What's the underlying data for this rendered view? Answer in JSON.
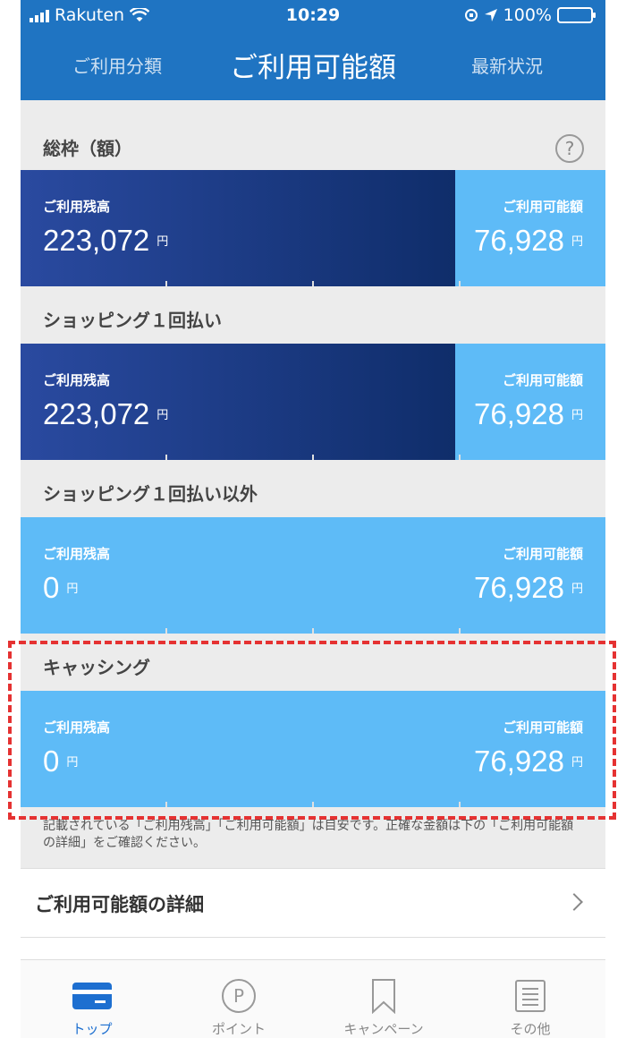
{
  "status": {
    "carrier": "Rakuten",
    "time": "10:29",
    "battery": "100%"
  },
  "header": {
    "left_tab": "ご利用分類",
    "title": "ご利用可能額",
    "right_tab": "最新状況"
  },
  "sections": [
    {
      "title": "総枠（額）",
      "used_label": "ご利用残高",
      "used": "223,072",
      "avail_label": "ご利用可能額",
      "avail": "76,928",
      "unit": "円",
      "dark": true
    },
    {
      "title": "ショッピング１回払い",
      "used_label": "ご利用残高",
      "used": "223,072",
      "avail_label": "ご利用可能額",
      "avail": "76,928",
      "unit": "円",
      "dark": true
    },
    {
      "title": "ショッピング１回払い以外",
      "used_label": "ご利用残高",
      "used": "0",
      "avail_label": "ご利用可能額",
      "avail": "76,928",
      "unit": "円",
      "dark": false
    },
    {
      "title": "キャッシング",
      "used_label": "ご利用残高",
      "used": "0",
      "avail_label": "ご利用可能額",
      "avail": "76,928",
      "unit": "円",
      "dark": false
    }
  ],
  "help_symbol": "?",
  "note": "記載されている「ご利用残高」「ご利用可能額」は目安です。正確な金額は下の「ご利用可能額の詳細」をご確認ください。",
  "detail_link": "ご利用可能額の詳細",
  "tabbar": {
    "items": [
      {
        "label": "トップ",
        "icon": "card-icon"
      },
      {
        "label": "ポイント",
        "icon": "point-icon"
      },
      {
        "label": "キャンペーン",
        "icon": "bookmark-icon"
      },
      {
        "label": "その他",
        "icon": "list-icon"
      }
    ]
  },
  "colors": {
    "header": "#1f74c2",
    "dark_bar": "#1a3a86",
    "light_bar": "#5ebbf7",
    "active_tab": "#1d6fd0",
    "highlight": "#e53232"
  }
}
